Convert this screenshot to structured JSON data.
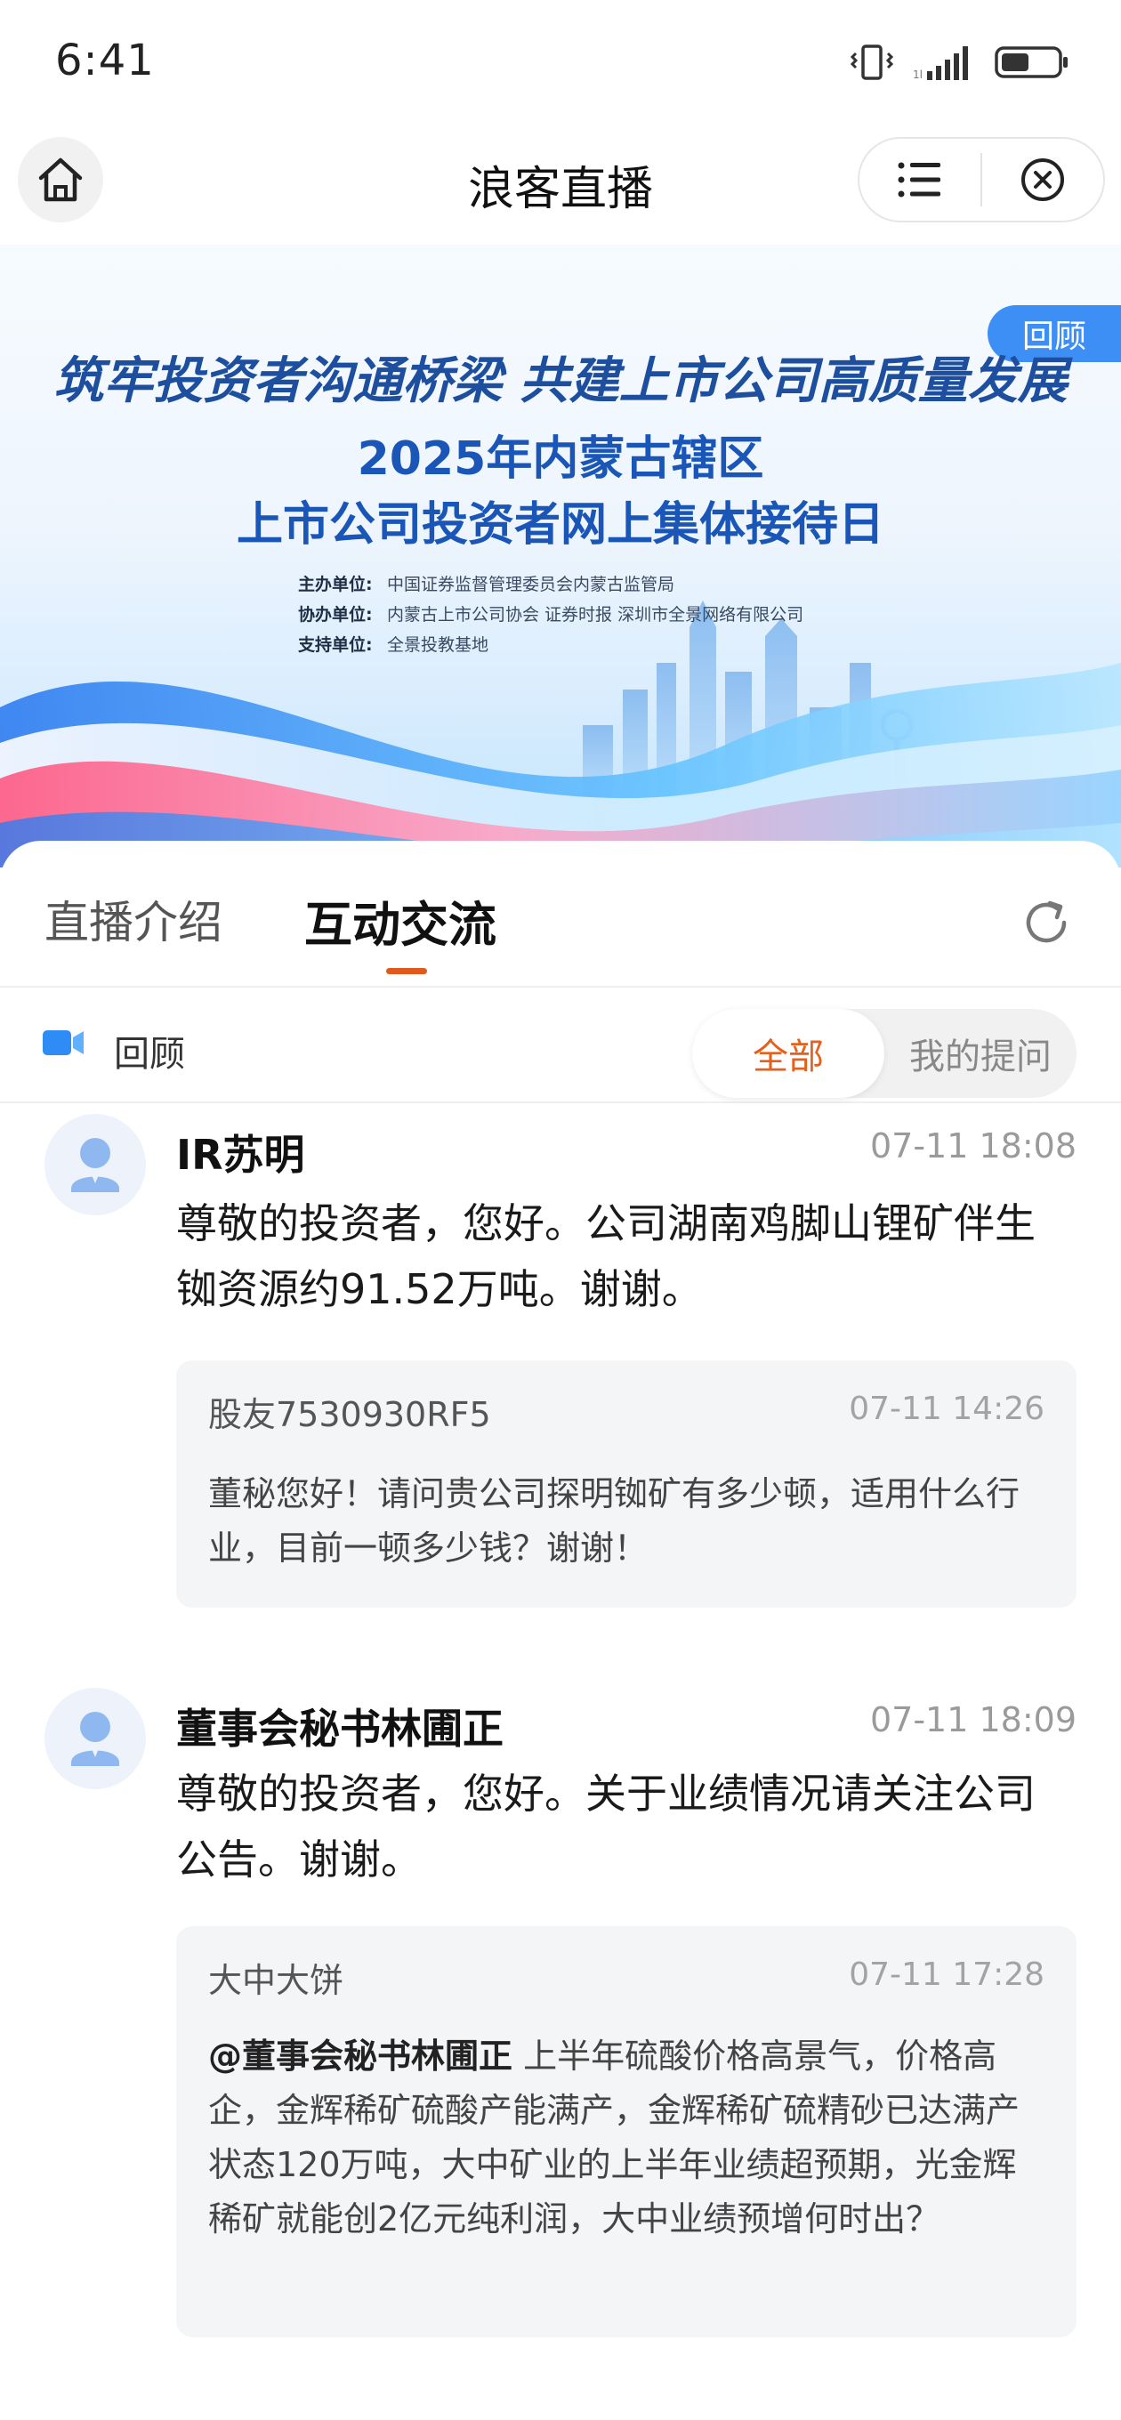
{
  "status_bar": {
    "time": "6:41"
  },
  "nav": {
    "title": "浪客直播"
  },
  "banner": {
    "replay_badge": "回顾",
    "slogan": "筑牢投资者沟通桥梁 共建上市公司高质量发展",
    "title_line1": "2025年内蒙古辖区",
    "title_line2": "上市公司投资者网上集体接待日",
    "orgs": [
      {
        "role": "主办单位:",
        "name": "中国证券监督管理委员会内蒙古监管局"
      },
      {
        "role": "协办单位:",
        "name": "内蒙古上市公司协会 证券时报 深圳市全景网络有限公司"
      },
      {
        "role": "支持单位:",
        "name": "全景投教基地"
      }
    ]
  },
  "tabs": {
    "intro": "直播介绍",
    "interact": "互动交流"
  },
  "filter": {
    "replay": "回顾",
    "all": "全部",
    "mine": "我的提问"
  },
  "posts": [
    {
      "name": "IR苏明",
      "time": "07-11 18:08",
      "answer": "尊敬的投资者，您好。公司湖南鸡脚山锂矿伴生铷资源约91.52万吨。谢谢。",
      "question_user": "股友7530930RF5",
      "question_time": "07-11 14:26",
      "question_mention": "",
      "question_text": "董秘您好！请问贵公司探明铷矿有多少顿，适用什么行业，目前一顿多少钱？谢谢！"
    },
    {
      "name": "董事会秘书林圃正",
      "time": "07-11 18:09",
      "answer": "尊敬的投资者，您好。关于业绩情况请关注公司公告。谢谢。",
      "question_user": "大中大饼",
      "question_time": "07-11 17:28",
      "question_mention": "@董事会秘书林圃正",
      "question_text": " 上半年硫酸价格高景气，价格高企，金辉稀矿硫酸产能满产，金辉稀矿硫精砂已达满产状态120万吨，大中矿业的上半年业绩超预期，光金辉稀矿就能创2亿元纯利润，大中业绩预增何时出？"
    }
  ],
  "colors": {
    "accent": "#e05a1e",
    "badge_blue": "#3d8ff5",
    "title_blue": "#1a56b8"
  }
}
